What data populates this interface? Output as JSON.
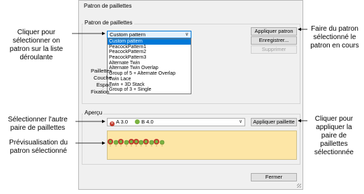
{
  "dialog": {
    "title": "Patron de paillettes"
  },
  "pattern_group": {
    "label": "Patron de paillettes",
    "combo_value": "Custom pattern",
    "options": [
      "Custom pattern",
      "PeacockPattern1",
      "PeacockPattern2",
      "PeacockPattern3",
      "Alternate Twin",
      "Alternate Twin Overlap",
      "Group of 5 + Alternate Overlap",
      "Twin Lace",
      "Twin + 3D Stack",
      "Group of 3 + Single"
    ],
    "selected_index": 0,
    "buttons": {
      "apply": "Appliquer patron",
      "save": "Enregistrer...",
      "delete": "Supprimer"
    },
    "side_labels": [
      "Paillettes",
      "Couche",
      "Espac.",
      "Fixation"
    ]
  },
  "preview_group": {
    "label": "Aperçu",
    "pair_a": "A 3.0",
    "pair_b": "B 4.0",
    "apply_button": "Appliquer paillette"
  },
  "close_button": "Fermer",
  "callouts": {
    "select_pattern": "Cliquer pour\nsélectionner on\npatron sur la liste\ndéroulante",
    "apply_pattern": "Faire du patron\nsélectionné le\npatron en cours",
    "other_pair": "Sélectionner l'autre\npaire de paillettes",
    "preview": "Prévisualisation du\npatron sélectionné",
    "apply_pair": "Cliquer pour\nappliquer la\npaire de\npaillettes\nsélectionnée"
  },
  "colors": {
    "accent": "#0078d7",
    "preview_bg": "#fde6a6",
    "sequin_red": "#c0392b",
    "sequin_green": "#7cb342"
  }
}
